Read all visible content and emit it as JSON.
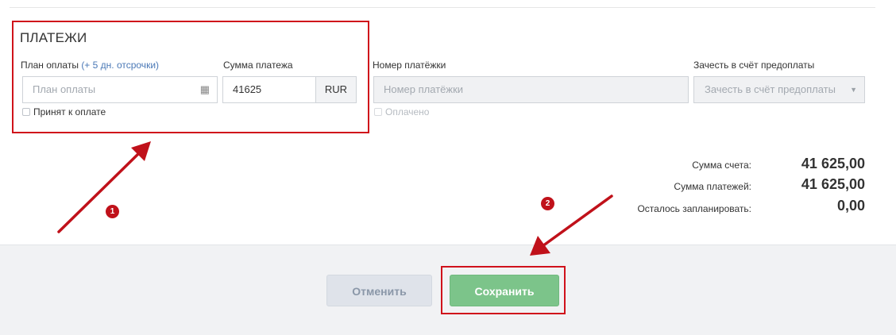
{
  "payments": {
    "title": "ПЛАТЕЖИ",
    "plan_label": "План оплаты",
    "plan_hint": "(+ 5 дн. отсрочки)",
    "plan_placeholder": "План оплаты",
    "amount_label": "Сумма платежа",
    "amount_value": "41625",
    "currency": "RUR",
    "accepted_label": "Принят к оплате",
    "number_label": "Номер платёжки",
    "number_placeholder": "Номер платёжки",
    "paid_label": "Оплачено",
    "prepay_label": "Зачесть в счёт предоплаты",
    "prepay_placeholder": "Зачесть в счёт предоплаты"
  },
  "summary": {
    "invoice_label": "Сумма счета:",
    "invoice_value": "41 625,00",
    "payments_label": "Сумма платежей:",
    "payments_value": "41 625,00",
    "remaining_label": "Осталось запланировать:",
    "remaining_value": "0,00"
  },
  "footer": {
    "cancel_label": "Отменить",
    "save_label": "Сохранить"
  },
  "annotations": {
    "badge_1": "1",
    "badge_2": "2",
    "highlight_color": "#d0121b"
  },
  "icons": {
    "calendar": "calendar-icon",
    "dropdown": "chevron-down-icon"
  }
}
